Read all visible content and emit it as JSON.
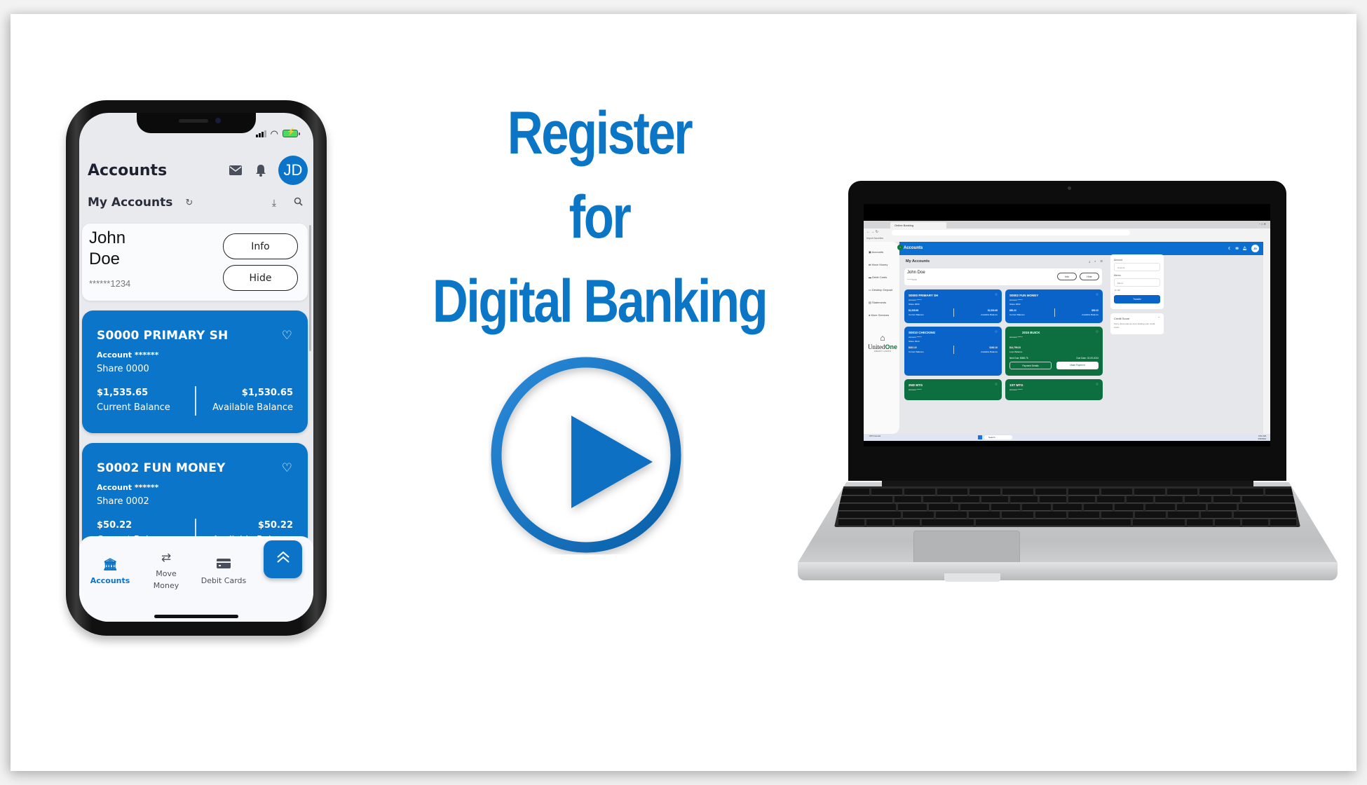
{
  "headline": {
    "line1": "Register",
    "line2": "for",
    "line3": "Digital Banking"
  },
  "colors": {
    "brand_blue": "#0b76c6",
    "card_blue": "#0b76c9",
    "loan_green": "#0d6e40",
    "phone_bg": "#e9eaee"
  },
  "play_button": {
    "icon": "play-icon",
    "label": "Play video"
  },
  "phone": {
    "status": {
      "signal": "signal-icon",
      "wifi": "wifi-icon",
      "battery": "battery-charging-icon"
    },
    "header": {
      "title": "Accounts",
      "icons": [
        "mail-icon",
        "bell-icon"
      ],
      "avatar_initials": "JD"
    },
    "subheader": {
      "title": "My Accounts",
      "icons": [
        "refresh-icon",
        "download-icon",
        "search-icon"
      ]
    },
    "user": {
      "first_name": "John",
      "last_name": "Doe",
      "masked_number": "******1234",
      "info_label": "Info",
      "hide_label": "Hide"
    },
    "accounts": [
      {
        "name": "S0000 PRIMARY SH",
        "account": "Account ******",
        "share": "Share 0000",
        "current_balance": "$1,535.65",
        "current_label": "Current Balance",
        "available_balance": "$1,530.65",
        "available_label": "Available Balance"
      },
      {
        "name": "S0002 FUN MONEY",
        "account": "Account ******",
        "share": "Share 0002",
        "current_balance": "$50.22",
        "current_label": "Current Balance",
        "available_balance": "$50.22",
        "available_label": "Available Balance"
      }
    ],
    "nav": [
      {
        "label": "Accounts",
        "icon": "bank-icon",
        "active": true
      },
      {
        "label": "Move Money",
        "icon": "transfer-arrows-icon",
        "active": false
      },
      {
        "label": "Debit Cards",
        "icon": "credit-card-icon",
        "active": false
      }
    ],
    "fab_icon": "chevrons-up-icon"
  },
  "laptop": {
    "browser": {
      "tab_title": "Online Banking",
      "favorites_label": "Import favorites"
    },
    "app": {
      "title": "Accounts",
      "avatar_initials": "JD",
      "sidebar": [
        {
          "label": "Accounts",
          "icon": "bank-icon"
        },
        {
          "label": "Move Money",
          "icon": "transfer-icon"
        },
        {
          "label": "Debit Cards",
          "icon": "credit-card-icon"
        },
        {
          "label": "Desktop Deposit",
          "icon": "deposit-icon"
        },
        {
          "label": "Statements",
          "icon": "statements-icon"
        },
        {
          "label": "More Services",
          "icon": "more-icon"
        }
      ],
      "logo": {
        "part1": "United",
        "part2": "One",
        "tagline": "CREDIT UNION"
      },
      "my_accounts": "My Accounts",
      "user": {
        "name": "John Doe",
        "masked": "******1234",
        "info": "Info",
        "hide": "Hide"
      },
      "cards": [
        {
          "name": "S0000 PRIMARY SH",
          "account": "Account ******",
          "share": "Share 0000",
          "current": "$1,535.65",
          "current_label": "Current Balance",
          "available": "$1,530.65",
          "available_label": "Available Balance",
          "type": "share"
        },
        {
          "name": "S0002 FUN MONEY",
          "account": "Account ******",
          "share": "Share 0002",
          "current": "$50.22",
          "current_label": "Current Balance",
          "available": "$50.22",
          "available_label": "Available Balance",
          "type": "share"
        },
        {
          "name": "S0010 CHECKING",
          "account": "Account ******",
          "share": "Share 0010",
          "current": "$162.10",
          "current_label": "Current Balance",
          "available": "$162.10",
          "available_label": "Available Balance",
          "type": "share"
        },
        {
          "name": "2015 BUICK",
          "account": "Account ******",
          "loan_balance": "$14,759.23",
          "loan_label": "Loan Balance",
          "next_due": "Next Due: $865.76",
          "due_date": "Due Date: 02-09-2024",
          "payment_details": "Payment Details",
          "make_payment": "Make Payment",
          "type": "loan"
        },
        {
          "name": "2ND MTG",
          "account": "Account ******",
          "type": "loan"
        },
        {
          "name": "1ST MTG",
          "account": "Account ******",
          "type": "loan"
        }
      ],
      "transfer": {
        "amount_label": "Amount",
        "amount_placeholder": "Amount",
        "memo_label": "Memo",
        "memo_placeholder": "Memo",
        "memo_count": "0 / 30",
        "button": "Transfer"
      },
      "credit_score": {
        "title": "Credit Score",
        "message": "Sorry, there was an error loading your credit score."
      }
    },
    "taskbar": {
      "weather_temp": "39°F",
      "weather_desc": "Humid",
      "search_placeholder": "Search",
      "time": "9:52 AM",
      "date": "4/5/2024"
    }
  }
}
